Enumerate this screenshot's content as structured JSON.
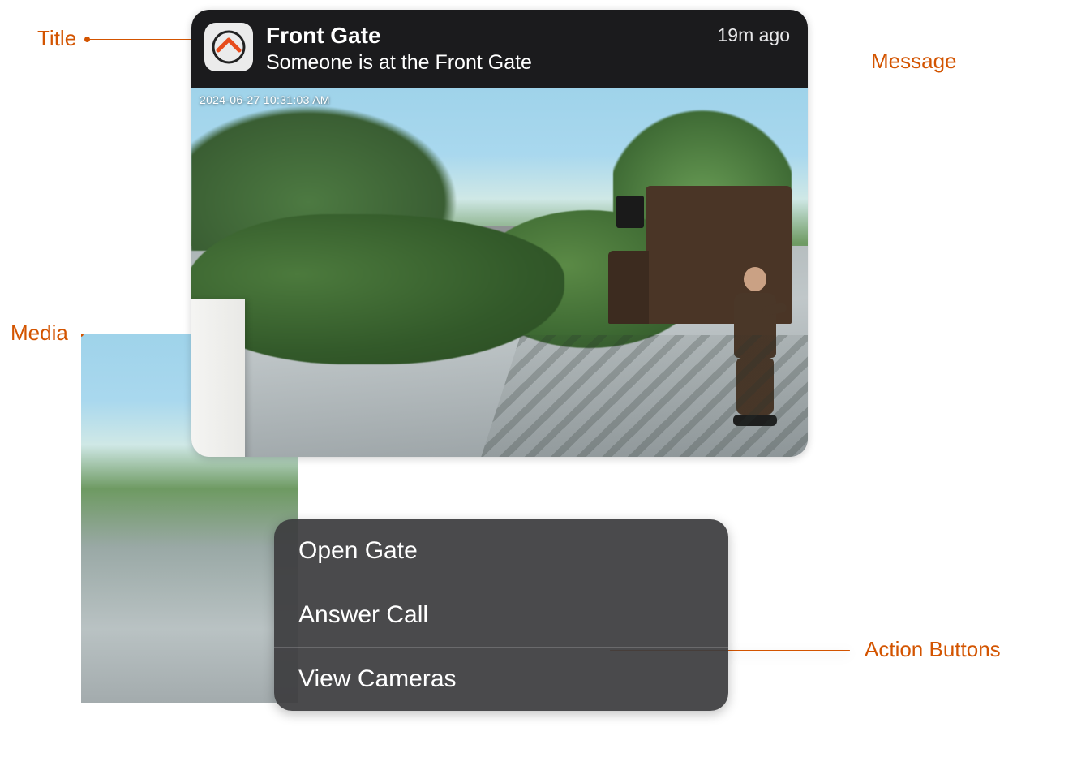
{
  "annotations": {
    "title": "Title",
    "message": "Message",
    "media": "Media",
    "actions": "Action Buttons"
  },
  "notification": {
    "app_icon": "home-security-icon",
    "title": "Front Gate",
    "message": "Someone is at the Front Gate",
    "timestamp": "19m ago",
    "media_timestamp": "2024-06-27  10:31:03 AM"
  },
  "actions": [
    {
      "id": "open-gate",
      "label": "Open Gate"
    },
    {
      "id": "answer-call",
      "label": "Answer Call"
    },
    {
      "id": "view-cameras",
      "label": "View Cameras"
    }
  ],
  "colors": {
    "annotation": "#d35400",
    "header_bg": "#1b1b1d",
    "action_bg": "#3c3c3e"
  }
}
